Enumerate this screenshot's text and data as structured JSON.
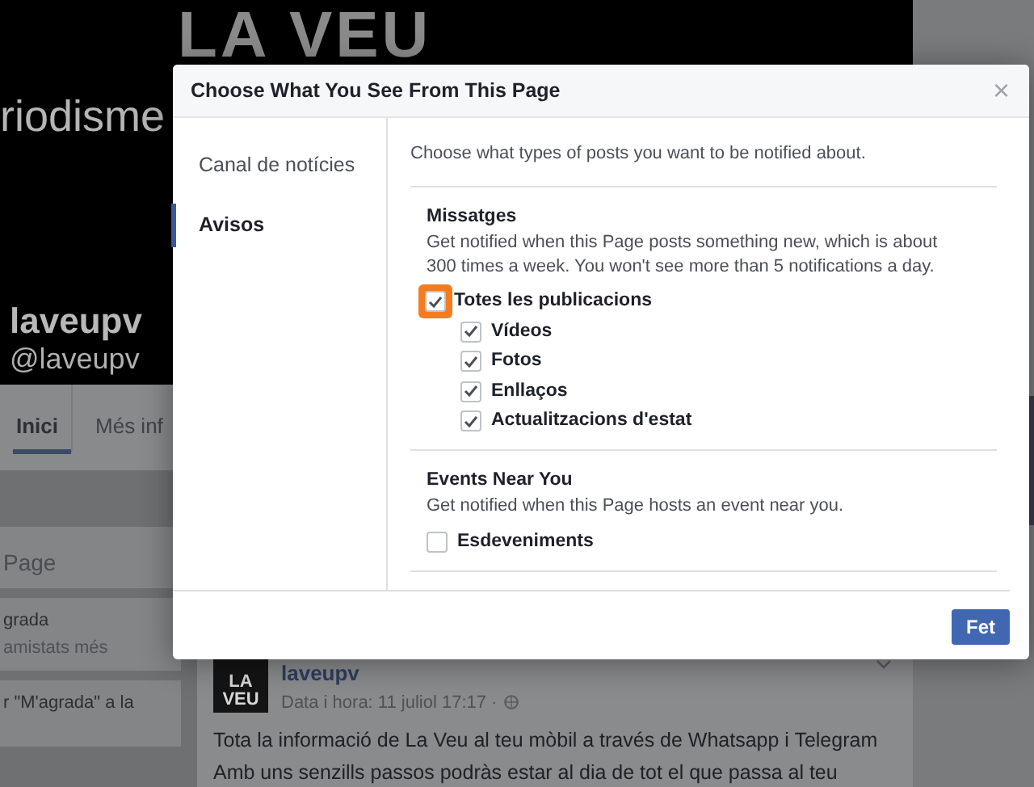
{
  "cover": {
    "title": "LA VEU",
    "subtitle": "riodisme",
    "name": "laveupv",
    "handle": "@laveupv"
  },
  "page_tabs": [
    {
      "label": "Inici",
      "selected": true
    },
    {
      "label": "Més inf",
      "selected": false
    }
  ],
  "left_column": {
    "search_text": "Page",
    "like_lines": [
      "grada",
      "amistats més"
    ],
    "invite_text": "r \"M'agrada\" a la"
  },
  "post": {
    "logo_lines": [
      "LA",
      "VEU"
    ],
    "author": "laveupv",
    "meta": "Data i hora: 11 juliol 17:17 ·",
    "lines": [
      "Tota la informació de La Veu al teu mòbil a través de Whatsapp i Telegram",
      "Amb uns senzills passos podràs estar al dia de tot el que passa al teu"
    ]
  },
  "dialog": {
    "title": "Choose What You See From This Page",
    "close": "×",
    "nav": [
      {
        "label": "Canal de notícies",
        "selected": false
      },
      {
        "label": "Avisos",
        "selected": true
      }
    ],
    "intro": "Choose what types of posts you want to be notified about.",
    "sections": [
      {
        "heading": "Missatges",
        "description": "Get notified when this Page posts something new, which is about 300 times a week. You won't see more than 5 notifications a day.",
        "options": [
          {
            "label": "Totes les publicacions",
            "checked": true,
            "highlighted": true,
            "children": [
              {
                "label": "Vídeos",
                "checked": true
              },
              {
                "label": "Fotos",
                "checked": true
              },
              {
                "label": "Enllaços",
                "checked": true
              },
              {
                "label": "Actualitzacions d'estat",
                "checked": true
              }
            ]
          }
        ]
      },
      {
        "heading": "Events Near You",
        "description": "Get notified when this Page hosts an event near you.",
        "options": [
          {
            "label": "Esdeveniments",
            "checked": false
          }
        ]
      }
    ],
    "button": "Fet"
  }
}
